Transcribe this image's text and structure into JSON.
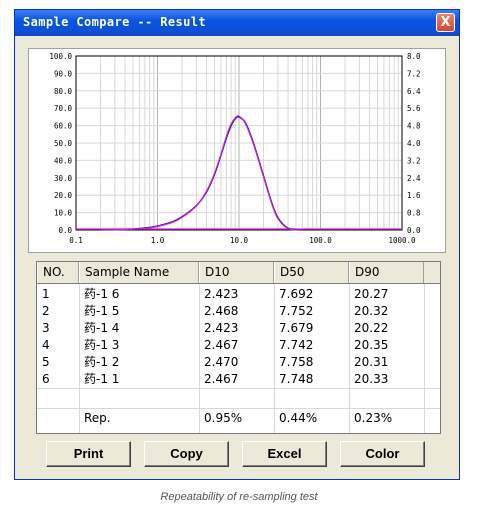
{
  "window": {
    "title": "Sample Compare -- Result",
    "close_glyph": "X"
  },
  "chart_data": {
    "type": "line",
    "x_scale": "log",
    "xlim": [
      0.1,
      1000.0
    ],
    "x_ticks": [
      "0.1",
      "1.0",
      "10.0",
      "100.0",
      "1000.0"
    ],
    "ylim_left": [
      0,
      100
    ],
    "y_ticks_left": [
      "100.0",
      "90.0",
      "80.0",
      "70.0",
      "60.0",
      "50.0",
      "40.0",
      "30.0",
      "20.0",
      "10.0",
      "0.0"
    ],
    "ylim_right": [
      0,
      8
    ],
    "y_ticks_right": [
      "8.0",
      "7.2",
      "6.4",
      "5.6",
      "4.8",
      "4.0",
      "3.2",
      "2.4",
      "1.6",
      "0.8",
      "0.0"
    ],
    "grid": true,
    "series": [
      {
        "color": "#1a1aa0",
        "x": [
          0.2,
          0.3,
          0.5,
          0.8,
          1.0,
          1.5,
          2.0,
          3.0,
          4.0,
          5.0,
          6.0,
          7.0,
          8.0,
          9.0,
          10.0,
          12.0,
          15.0,
          20.0,
          25.0,
          30.0,
          40.0,
          60.0
        ],
        "y": [
          0.05,
          0.15,
          0.5,
          1.4,
          2.2,
          4.5,
          7.5,
          14.0,
          22.0,
          32.0,
          43.0,
          53.0,
          60.0,
          64.0,
          65.0,
          61.5,
          50.0,
          31.0,
          16.0,
          7.0,
          1.0,
          0.0
        ]
      },
      {
        "color": "#e020e0",
        "x": [
          0.2,
          0.3,
          0.5,
          0.8,
          1.0,
          1.5,
          2.0,
          3.0,
          4.0,
          5.0,
          6.0,
          7.0,
          8.0,
          9.0,
          10.0,
          12.0,
          15.0,
          20.0,
          25.0,
          30.0,
          40.0,
          60.0
        ],
        "y": [
          0.05,
          0.15,
          0.5,
          1.2,
          2.0,
          4.2,
          7.2,
          13.8,
          22.5,
          32.5,
          43.5,
          54.0,
          61.0,
          64.5,
          65.5,
          61.0,
          49.5,
          30.5,
          15.5,
          6.5,
          0.8,
          0.0
        ]
      }
    ]
  },
  "table": {
    "columns": [
      "NO.",
      "Sample Name",
      "D10",
      "D50",
      "D90"
    ],
    "rows": [
      [
        "1",
        "药-1 6",
        "2.423",
        "7.692",
        "20.27"
      ],
      [
        "2",
        "药-1 5",
        "2.468",
        "7.752",
        "20.32"
      ],
      [
        "3",
        "药-1 4",
        "2.423",
        "7.679",
        "20.22"
      ],
      [
        "4",
        "药-1 3",
        "2.467",
        "7.742",
        "20.35"
      ],
      [
        "5",
        "药-1 2",
        "2.470",
        "7.758",
        "20.31"
      ],
      [
        "6",
        "药-1 1",
        "2.467",
        "7.748",
        "20.33"
      ]
    ],
    "rep_row": [
      "",
      "Rep.",
      "0.95%",
      "0.44%",
      "0.23%"
    ]
  },
  "buttons": {
    "print": "Print",
    "copy": "Copy",
    "excel": "Excel",
    "color": "Color"
  },
  "caption": "Repeatability of re-sampling test"
}
